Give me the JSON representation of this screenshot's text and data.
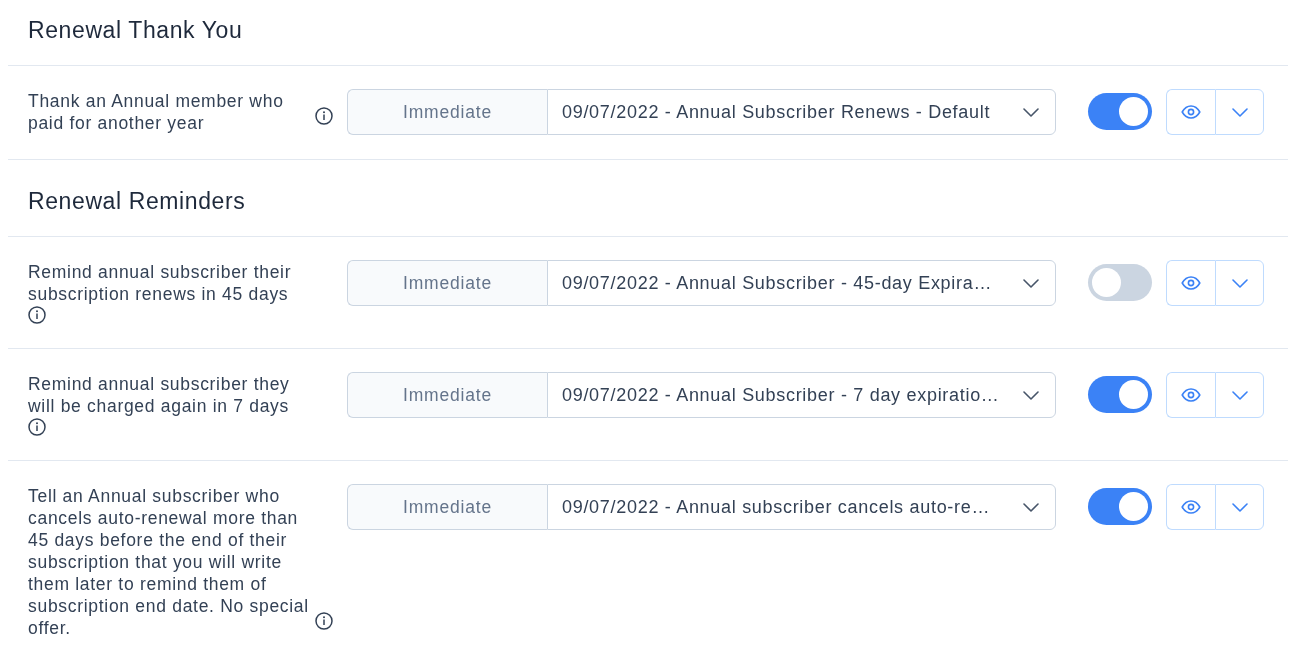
{
  "sections": [
    {
      "heading": "Renewal Thank You",
      "rows": [
        {
          "description": "Thank an Annual member who paid for another year",
          "timing": "Immediate",
          "template": "09/07/2022 - Annual Subscriber Renews - Default",
          "enabled": true
        }
      ]
    },
    {
      "heading": "Renewal Reminders",
      "rows": [
        {
          "description": "Remind annual subscriber their subscription renews in 45 days",
          "timing": "Immediate",
          "template": "09/07/2022 - Annual Subscriber - 45-day Expira…",
          "enabled": false
        },
        {
          "description": "Remind annual subscriber they will be charged again in 7 days",
          "timing": "Immediate",
          "template": "09/07/2022 - Annual Subscriber - 7 day expiratio…",
          "enabled": true
        },
        {
          "description": "Tell an Annual subscriber who cancels auto-renewal more than 45 days before the end of their subscription that you will write them later to remind them of subscription end date. No special offer.",
          "timing": "Immediate",
          "template": "09/07/2022 - Annual subscriber cancels auto-re…",
          "enabled": true
        }
      ]
    }
  ]
}
